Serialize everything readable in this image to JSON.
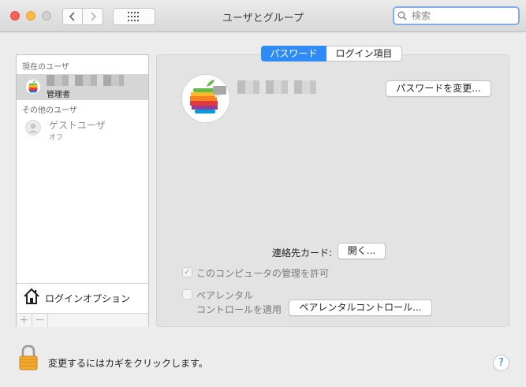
{
  "window": {
    "title": "ユーザとグループ",
    "search_placeholder": "検索"
  },
  "sidebar": {
    "current_users_heading": "現在のユーザ",
    "current_user_role": "管理者",
    "other_users_heading": "その他のユーザ",
    "guest_name": "ゲストユーザ",
    "guest_status": "オフ",
    "login_options_label": "ログインオプション",
    "add_label": "+",
    "remove_label": "−"
  },
  "tabs": [
    "パスワード",
    "ログイン項目"
  ],
  "main": {
    "change_password_button": "パスワードを変更...",
    "contact_card_label": "連絡先カード:",
    "open_button": "開く...",
    "allow_admin_label": "このコンピュータの管理を許可",
    "allow_admin_checked": true,
    "parental_label_line1": "ペアレンタル",
    "parental_label_line2": "コントロールを適用",
    "parental_checked": false,
    "parental_controls_button": "ペアレンタルコントロール..."
  },
  "footer": {
    "lock_text": "変更するにはカギをクリックします。",
    "help_label": "?"
  },
  "icons": {
    "close": "close-light-icon",
    "minimize": "minimize-light-icon",
    "zoom": "zoom-light-icon",
    "back": "chevron-left-icon",
    "forward": "chevron-right-icon",
    "grid": "grid-icon",
    "search": "search-icon",
    "user_avatar": "apple-logo-avatar-icon",
    "guest_avatar": "guest-user-icon",
    "home": "house-icon",
    "lock": "padlock-icon"
  },
  "colors": {
    "accent": "#2f8cf6",
    "window_bg": "#ececec",
    "panel_bg": "#e3e3e3",
    "help_text": "#1f6fd6"
  }
}
